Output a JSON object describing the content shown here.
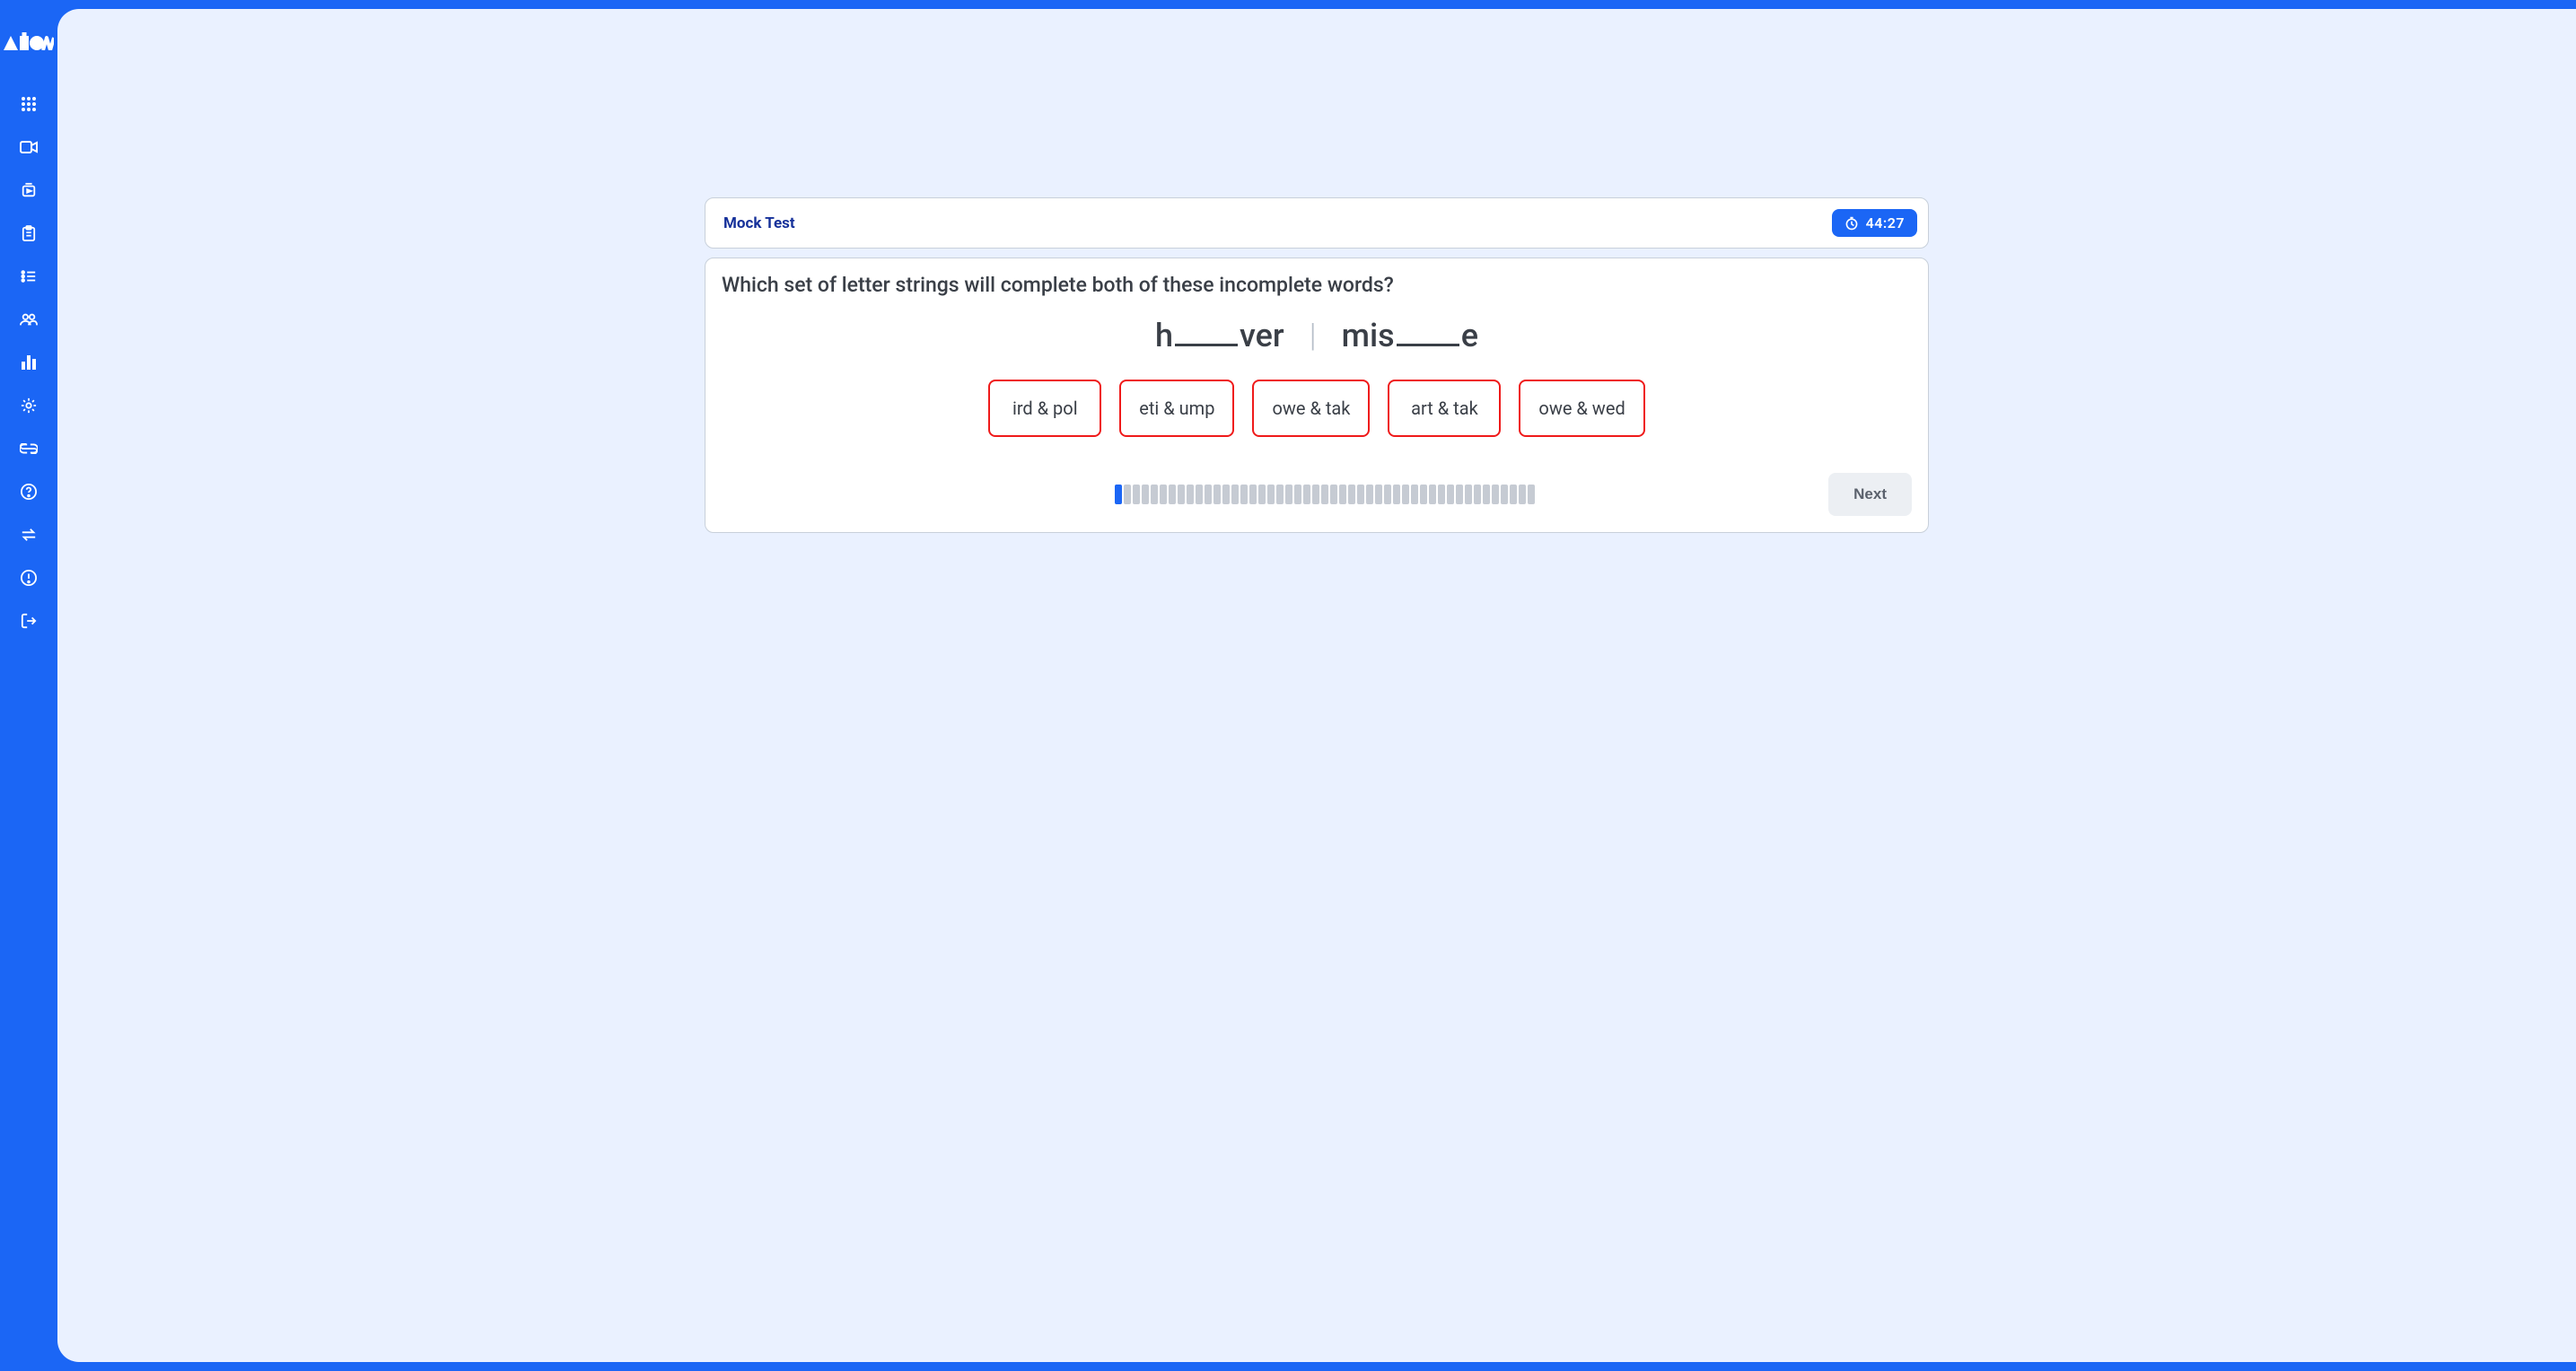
{
  "sidebar": {
    "brand": "ATOM"
  },
  "header": {
    "title": "Mock Test",
    "timer": "44:27"
  },
  "question": {
    "prompt": "Which set of letter strings will complete both of these incomplete words?",
    "word1_pre": "h",
    "word1_post": "ver",
    "word2_pre": "mis",
    "word2_post": "e",
    "options": [
      "ird & pol",
      "eti & ump",
      "owe & tak",
      "art & tak",
      "owe & wed"
    ]
  },
  "progress": {
    "total": 47,
    "current": 1
  },
  "buttons": {
    "next": "Next"
  }
}
